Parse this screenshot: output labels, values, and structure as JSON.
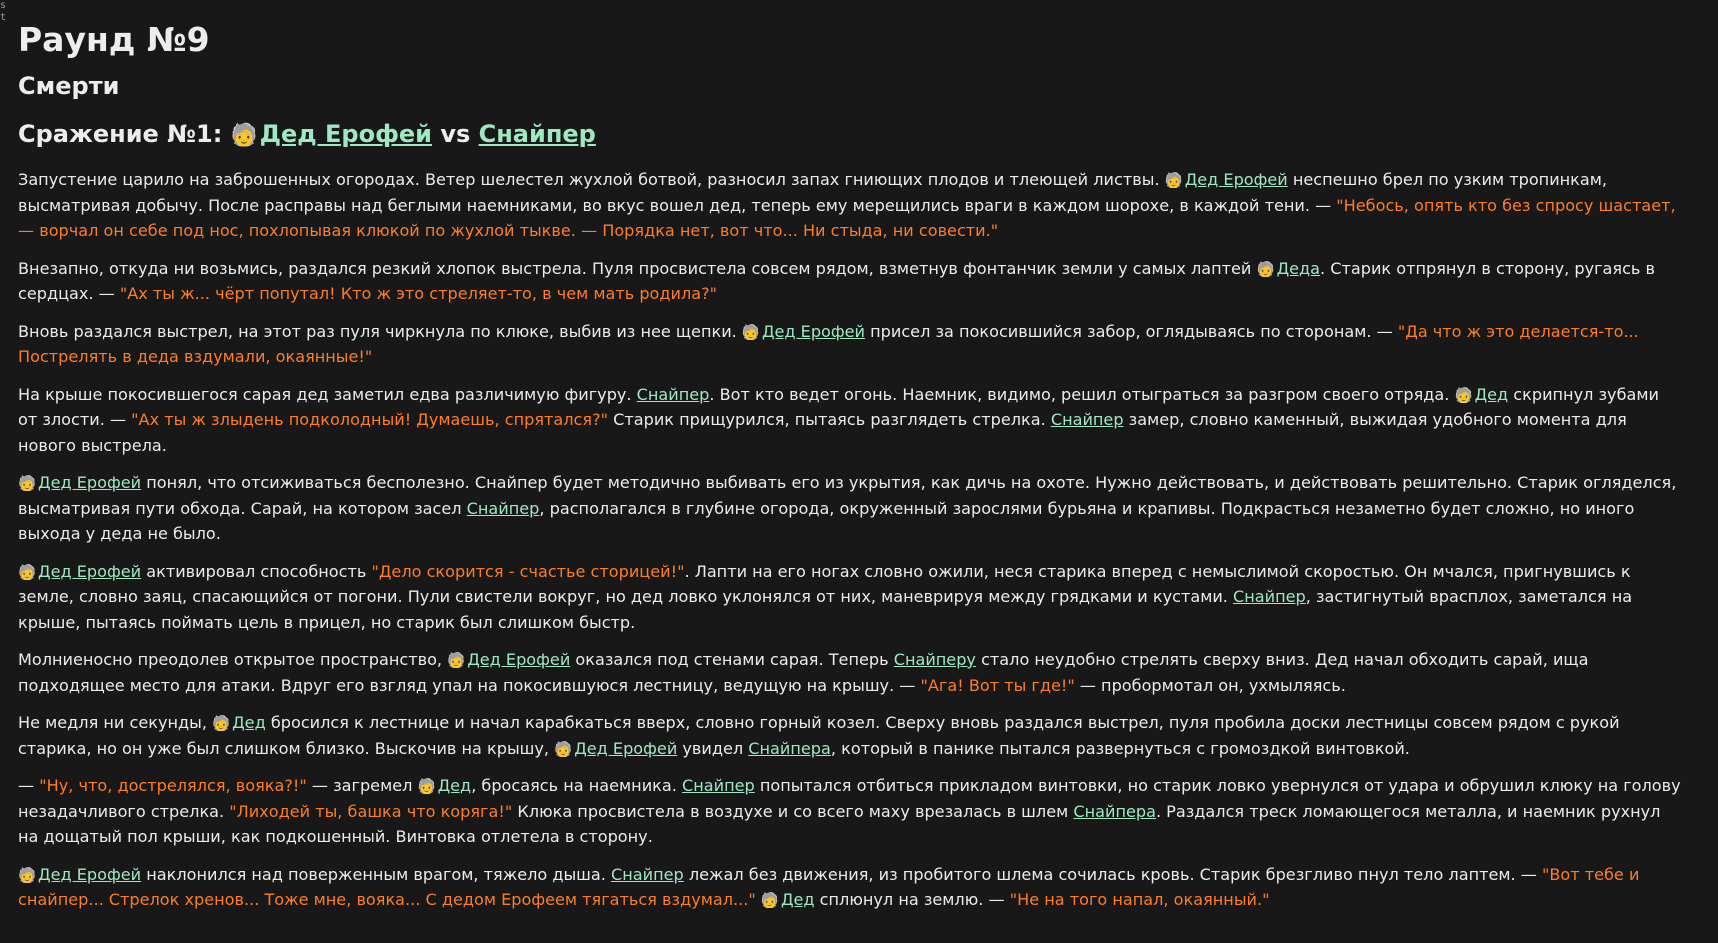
{
  "corner_glyphs": [
    "s",
    "t"
  ],
  "round_title": "Раунд №9",
  "section_title": "Смерти",
  "battle": {
    "prefix": "Сражение №1: ",
    "fighter1": "Дед Ерофей",
    "vs": " vs ",
    "fighter2": "Снайпер"
  },
  "icons": {
    "grandpa": "🧓",
    "sniper": ""
  },
  "paragraphs": {
    "p1": {
      "t1": "Запустение царило на заброшенных огородах. Ветер шелестел жухлой ботвой, разносил запах гниющих плодов и тлеющей листвы. ",
      "l1": "Дед Ерофей",
      "t2": " неспешно брел по узким тропинкам, высматривая добычу. После расправы над беглыми наемниками, во вкус вошел дед, теперь ему мерещились враги в каждом шорохе, в каждой тени. — ",
      "q1": "\"Небось, опять кто без спросу шастает, — ворчал он себе под нос, похлопывая клюкой по жухлой тыкве. — Порядка нет, вот что... Ни стыда, ни совести.\""
    },
    "p2": {
      "t1": "Внезапно, откуда ни возьмись, раздался резкий хлопок выстрела. Пуля просвистела совсем рядом, взметнув фонтанчик земли у самых лаптей ",
      "l1": "Деда",
      "t2": ". Старик отпрянул в сторону, ругаясь в сердцах. — ",
      "q1": "\"Ах ты ж... чёрт попутал! Кто ж это стреляет-то, в чем мать родила?\""
    },
    "p3": {
      "t1": "Вновь раздался выстрел, на этот раз пуля чиркнула по клюке, выбив из нее щепки. ",
      "l1": "Дед Ерофей",
      "t2": " присел за покосившийся забор, оглядываясь по сторонам. — ",
      "q1": "\"Да что ж это делается-то... Пострелять в деда вздумали, окаянные!\""
    },
    "p4": {
      "t1": "На крыше покосившегося сарая дед заметил едва различимую фигуру. ",
      "l1": "Снайпер",
      "t2": ". Вот кто ведет огонь. Наемник, видимо, решил отыграться за разгром своего отряда. ",
      "l2": "Дед",
      "t3": " скрипнул зубами от злости. — ",
      "q1": "\"Ах ты ж злыдень подколодный! Думаешь, спрятался?\"",
      "t4": " Старик прищурился, пытаясь разглядеть стрелка. ",
      "l3": "Снайпер",
      "t5": " замер, словно каменный, выжидая удобного момента для нового выстрела."
    },
    "p5": {
      "l1": "Дед Ерофей",
      "t1": " понял, что отсиживаться бесполезно. Снайпер будет методично выбивать его из укрытия, как дичь на охоте. Нужно действовать, и действовать решительно. Старик огляделся, высматривая пути обхода. Сарай, на котором засел ",
      "l2": "Снайпер",
      "t2": ", располагался в глубине огорода, окруженный зарослями бурьяна и крапивы. Подкрасться незаметно будет сложно, но иного выхода у деда не было."
    },
    "p6": {
      "l1": "Дед Ерофей",
      "t1": " активировал способность ",
      "q1": "\"Дело скорится - счастье сторицей!\"",
      "t2": ". Лапти на его ногах словно ожили, неся старика вперед с немыслимой скоростью. Он мчался, пригнувшись к земле, словно заяц, спасающийся от погони. Пули свистели вокруг, но дед ловко уклонялся от них, маневрируя между грядками и кустами. ",
      "l2": "Снайпер",
      "t3": ", застигнутый врасплох, заметался на крыше, пытаясь поймать цель в прицел, но старик был слишком быстр."
    },
    "p7": {
      "t1": "Молниеносно преодолев открытое пространство, ",
      "l1": "Дед Ерофей",
      "t2": " оказался под стенами сарая. Теперь ",
      "l2": "Снайперу",
      "t3": " стало неудобно стрелять сверху вниз. Дед начал обходить сарай, ища подходящее место для атаки. Вдруг его взгляд упал на покосившуюся лестницу, ведущую на крышу. — ",
      "q1": "\"Ага! Вот ты где!\"",
      "t4": " — пробормотал он, ухмыляясь."
    },
    "p8": {
      "t1": "Не медля ни секунды, ",
      "l1": "Дед",
      "t2": " бросился к лестнице и начал карабкаться вверх, словно горный козел. Сверху вновь раздался выстрел, пуля пробила доски лестницы совсем рядом с рукой старика, но он уже был слишком близко. Выскочив на крышу, ",
      "l2": "Дед Ерофей",
      "t3": " увидел ",
      "l3": "Снайпера",
      "t4": ", который в панике пытался развернуться с громоздкой винтовкой."
    },
    "p9": {
      "t1": "— ",
      "q1": "\"Ну, что, дострелялся, вояка?!\"",
      "t2": " — загремел ",
      "l1": "Дед",
      "t3": ", бросаясь на наемника. ",
      "l2": "Снайпер",
      "t4": " попытался отбиться прикладом винтовки, но старик ловко увернулся от удара и обрушил клюку на голову незадачливого стрелка. ",
      "q2": "\"Лиходей ты, башка что коряга!\"",
      "t5": " Клюка просвистела в воздухе и со всего маху врезалась в шлем ",
      "l3": "Снайпера",
      "t6": ". Раздался треск ломающегося металла, и наемник рухнул на дощатый пол крыши, как подкошенный. Винтовка отлетела в сторону."
    },
    "p10": {
      "l1": "Дед Ерофей",
      "t1": " наклонился над поверженным врагом, тяжело дыша. ",
      "l2": "Снайпер",
      "t2": " лежал без движения, из пробитого шлема сочилась кровь. Старик брезгливо пнул тело лаптем. — ",
      "q1": "\"Вот тебе и снайпер... Стрелок хренов... Тоже мне, вояка... С дедом Ерофеем тягаться вздумал...\"",
      "t3": " ",
      "l3": "Дед",
      "t4": " сплюнул на землю. — ",
      "q2": "\"Не на того напал, окаянный.\""
    }
  }
}
